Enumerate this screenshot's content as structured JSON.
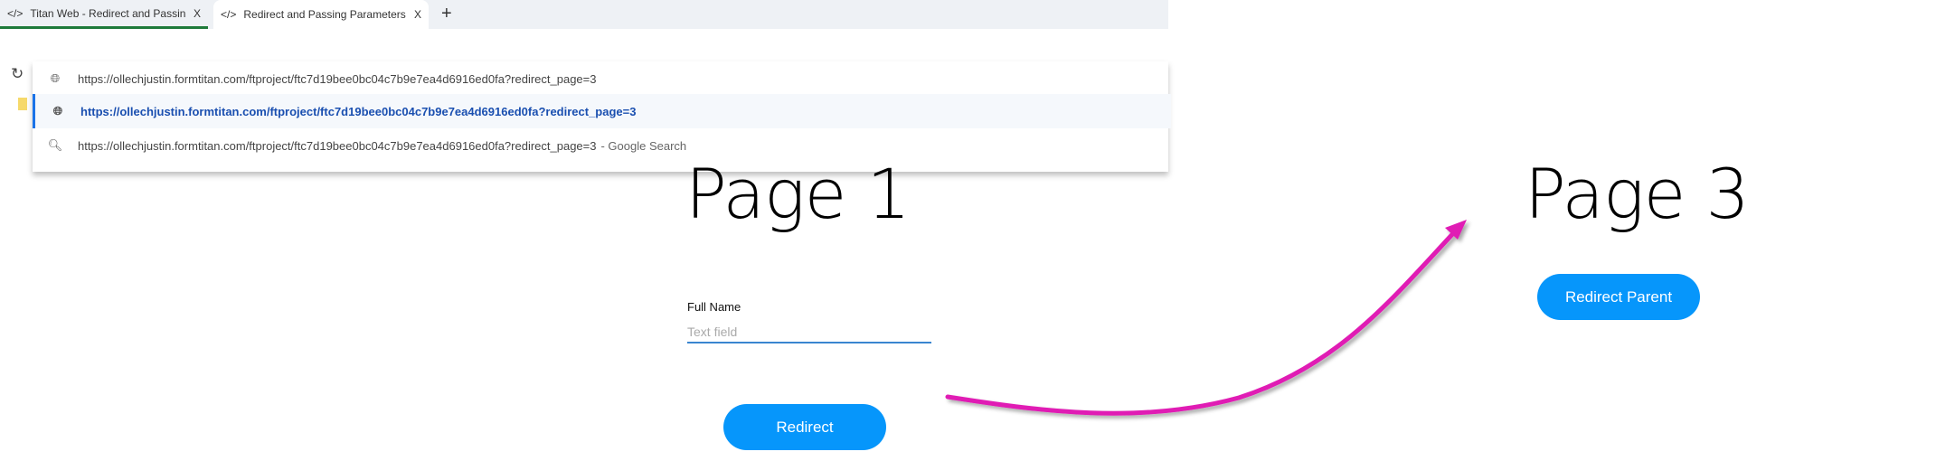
{
  "browser": {
    "tabs": [
      {
        "title": "Titan Web - Redirect and Passing",
        "close": "X"
      },
      {
        "title": "Redirect and Passing Parameters",
        "close": "X"
      }
    ],
    "new_tab": "+",
    "omnibox_suggestions": [
      {
        "text": "https://ollechjustin.formtitan.com/ftproject/ftc7d19bee0bc04c7b9e7ea4d6916ed0fa?redirect_page=3",
        "icon": "globe-icon"
      },
      {
        "text": "https://ollechjustin.formtitan.com/ftproject/ftc7d19bee0bc04c7b9e7ea4d6916ed0fa?redirect_page=3",
        "icon": "globe-icon"
      },
      {
        "text": "https://ollechjustin.formtitan.com/ftproject/ftc7d19bee0bc04c7b9e7ea4d6916ed0fa?redirect_page=3",
        "suffix": "- Google Search",
        "icon": "search-icon"
      }
    ]
  },
  "page1": {
    "title": "Page 1",
    "field_label": "Full Name",
    "field_placeholder": "Text field",
    "button": "Redirect"
  },
  "page3": {
    "title": "Page 3",
    "button": "Redirect Parent"
  },
  "colors": {
    "button": "#0696fb",
    "arrow": "#e01ab4",
    "active_tab": "#1e7a3a"
  }
}
